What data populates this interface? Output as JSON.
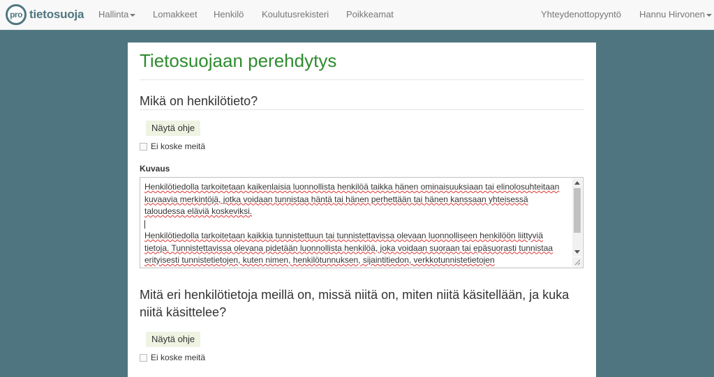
{
  "brand": {
    "badge": "pro",
    "name": "tietosuoja"
  },
  "nav": {
    "items": [
      {
        "label": "Hallinta",
        "dropdown": true
      },
      {
        "label": "Lomakkeet"
      },
      {
        "label": "Henkilö"
      },
      {
        "label": "Koulutusrekisteri"
      },
      {
        "label": "Poikkeamat"
      }
    ],
    "right": [
      {
        "label": "Yhteydenottopyyntö"
      },
      {
        "label": "Hannu Hirvonen",
        "dropdown": true
      }
    ]
  },
  "page": {
    "title": "Tietosuojaan perehdytys"
  },
  "sections": [
    {
      "question": "Mikä on henkilötieto?",
      "help_button": "Näytä ohje",
      "not_applicable": "Ei koske meitä",
      "description_label": "Kuvaus",
      "description": {
        "paragraph1": "Henkilötiedolla tarkoitetaan kaikenlaisia luonnollista henkilöä taikka hänen ominaisuuksiaan tai elinolosuhteitaan kuvaavia merkintöjä, jotka voidaan tunnistaa häntä tai hänen perhettään tai hänen kanssaan yhteisessä taloudessa eläviä koskeviksi.",
        "paragraph2": "Henkilötiedolla tarkoitetaan kaikkia tunnistettuun tai tunnistettavissa olevaan luonnolliseen henkilöön liittyviä tietoja. Tunnistettavissa olevana pidetään luonnollista henkilöä, joka voidaan suoraan tai epäsuorasti tunnistaa erityisesti tunnistetietojen, kuten nimen, henkilötunnuksen, sijaintitiedon, verkkotunnistetietojen"
      }
    },
    {
      "question": "Mitä eri henkilötietoja meillä on, missä niitä on, miten niitä käsitellään, ja kuka niitä käsittelee?",
      "help_button": "Näytä ohje",
      "not_applicable": "Ei koske meitä"
    }
  ],
  "colors": {
    "background": "#4f7680",
    "title_green": "#2e8b2e",
    "help_button_bg": "#eef3e2",
    "navbar_bg": "#f8f8f8"
  },
  "icons": [
    "dropdown-caret",
    "scroll-up-arrow",
    "scroll-down-arrow",
    "resize-grip"
  ]
}
